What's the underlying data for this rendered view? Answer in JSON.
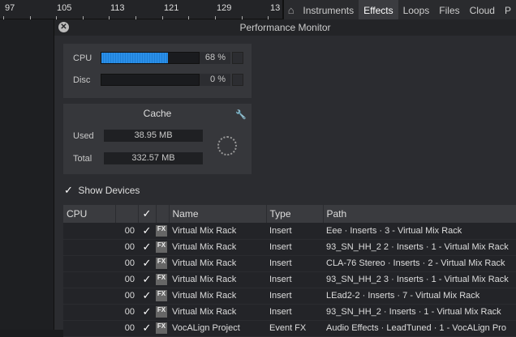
{
  "ruler": {
    "ticks": [
      "97",
      "105",
      "113",
      "121",
      "129",
      "13"
    ]
  },
  "browser": {
    "tabs": [
      {
        "label": "Instruments"
      },
      {
        "label": "Effects",
        "active": true
      },
      {
        "label": "Loops"
      },
      {
        "label": "Files"
      },
      {
        "label": "Cloud"
      },
      {
        "label": "P"
      }
    ]
  },
  "monitor": {
    "title": "Performance Monitor",
    "cpu": {
      "label": "CPU",
      "value": "68 %",
      "level": 0.68
    },
    "disc": {
      "label": "Disc",
      "value": "0 %",
      "level": 0
    },
    "cache": {
      "title": "Cache",
      "used_label": "Used",
      "used": "38.95 MB",
      "total_label": "Total",
      "total": "332.57 MB"
    },
    "show_devices": {
      "label": "Show Devices",
      "checked": true
    },
    "table": {
      "headers": [
        "CPU",
        "",
        "Name",
        "Type",
        "Path"
      ],
      "rows": [
        {
          "cpu": "00",
          "name": "Virtual Mix Rack",
          "type": "Insert",
          "path": "Eee · Inserts · 3 - Virtual Mix Rack"
        },
        {
          "cpu": "00",
          "name": "Virtual Mix Rack",
          "type": "Insert",
          "path": "93_SN_HH_2 2 · Inserts · 1 - Virtual Mix Rack"
        },
        {
          "cpu": "00",
          "name": "Virtual Mix Rack",
          "type": "Insert",
          "path": "CLA-76 Stereo · Inserts · 2 - Virtual Mix Rack"
        },
        {
          "cpu": "00",
          "name": "Virtual Mix Rack",
          "type": "Insert",
          "path": "93_SN_HH_2 3 · Inserts · 1 - Virtual Mix Rack"
        },
        {
          "cpu": "00",
          "name": "Virtual Mix Rack",
          "type": "Insert",
          "path": "LEad2-2 · Inserts · 7 - Virtual Mix Rack"
        },
        {
          "cpu": "00",
          "name": "Virtual Mix Rack",
          "type": "Insert",
          "path": "93_SN_HH_2 · Inserts · 1 - Virtual Mix Rack"
        },
        {
          "cpu": "00",
          "name": "VocALign Project",
          "type": "Event FX",
          "path": "Audio Effects · LeadTuned · 1 - VocALign Pro"
        }
      ]
    }
  }
}
